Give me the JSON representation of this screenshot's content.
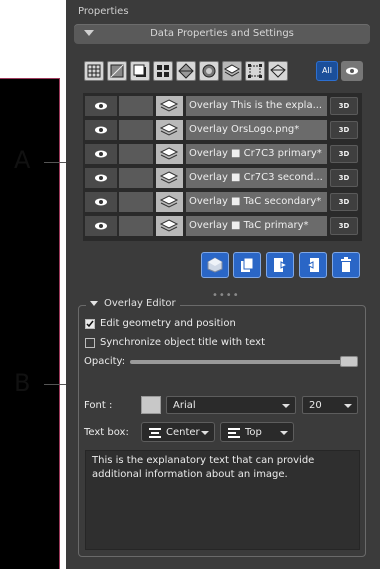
{
  "panel": {
    "title": "Properties",
    "section_label": "Data Properties and Settings"
  },
  "callouts": {
    "a": "A",
    "b": "B"
  },
  "toolbar": {
    "all_label": "All",
    "tools": [
      "grid-tool-icon",
      "cube-tool-icon",
      "box-tool-icon",
      "multi-box-icon",
      "diamond-icon",
      "sphere-icon",
      "layers-icon",
      "bounding-box-icon",
      "shape-icon"
    ]
  },
  "overlays": [
    {
      "name": "Overlay This is the expla...",
      "btn_3d": "3D"
    },
    {
      "name": "Overlay OrsLogo.png*",
      "btn_3d": "3D"
    },
    {
      "name": "Overlay ■ Cr7C3 primary*",
      "btn_3d": "3D"
    },
    {
      "name": "Overlay ■ Cr7C3 second...",
      "btn_3d": "3D"
    },
    {
      "name": "Overlay ■ TaC secondary*",
      "btn_3d": "3D"
    },
    {
      "name": "Overlay ■ TaC primary*",
      "btn_3d": "3D"
    }
  ],
  "actions": [
    "add-overlay-icon",
    "duplicate-icon",
    "export-icon",
    "import-icon",
    "delete-icon"
  ],
  "editor": {
    "title": "Overlay Editor",
    "edit_geometry_label": "Edit geometry and position",
    "edit_geometry_checked": true,
    "sync_title_label": "Synchronize object title with text",
    "sync_title_checked": false,
    "opacity_label": "Opacity:",
    "opacity_value": 1.0,
    "font_label": "Font :",
    "font_value": "Arial",
    "font_size": "20",
    "textbox_label": "Text box:",
    "halign_value": "Center",
    "valign_value": "Top",
    "text_content": "This is the explanatory text that can provide additional information about an image."
  },
  "colors": {
    "accent": "#2a66c6",
    "viewport_border": "#9d3b5c"
  }
}
